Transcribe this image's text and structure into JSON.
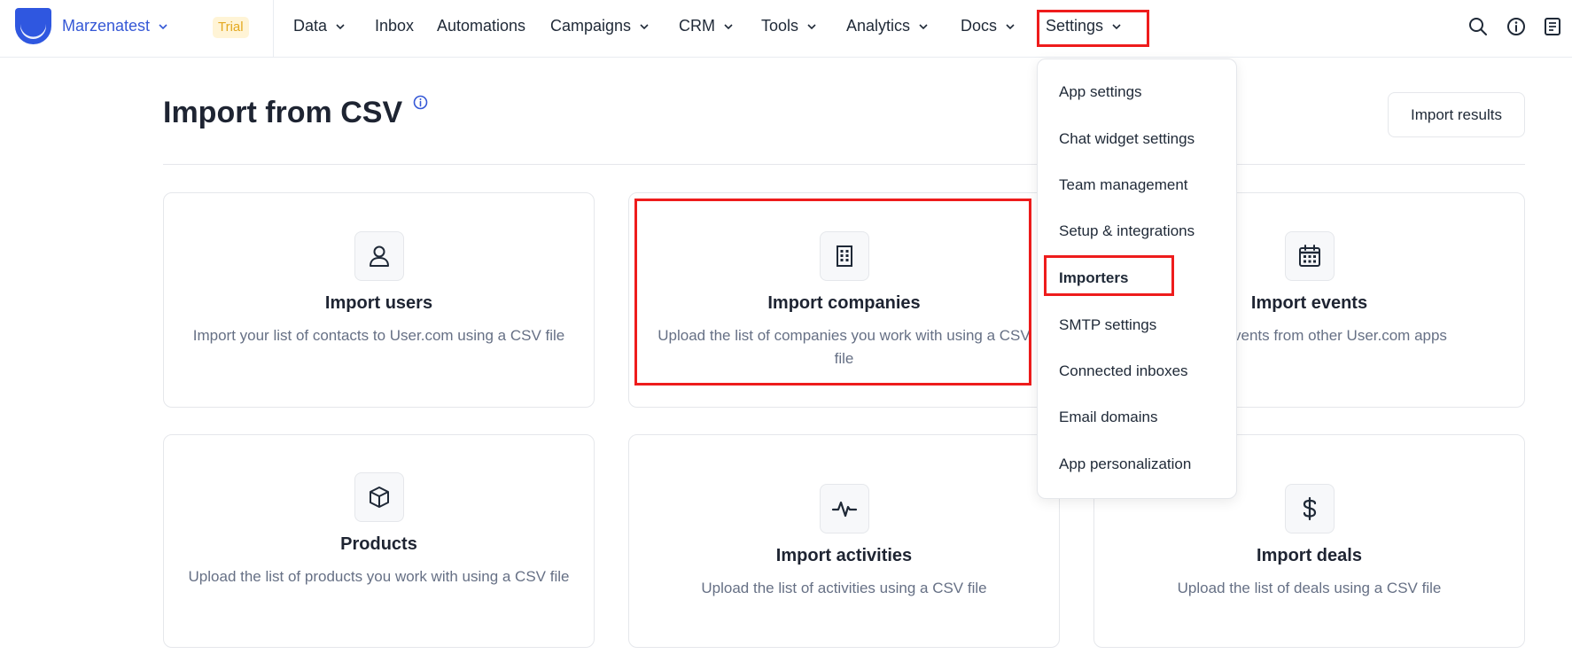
{
  "header": {
    "workspace": "Marzenatest",
    "trial_badge": "Trial",
    "nav": [
      {
        "label": "Data",
        "has_dropdown": true
      },
      {
        "label": "Inbox",
        "has_dropdown": false
      },
      {
        "label": "Automations",
        "has_dropdown": false
      },
      {
        "label": "Campaigns",
        "has_dropdown": true
      },
      {
        "label": "CRM",
        "has_dropdown": true
      },
      {
        "label": "Tools",
        "has_dropdown": true
      },
      {
        "label": "Analytics",
        "has_dropdown": true
      },
      {
        "label": "Docs",
        "has_dropdown": true
      },
      {
        "label": "Settings",
        "has_dropdown": true,
        "open": true
      }
    ],
    "icons": [
      "search-icon",
      "info-icon",
      "docs-icon"
    ]
  },
  "page": {
    "title": "Import from CSV",
    "import_results_label": "Import results"
  },
  "cards": [
    {
      "title": "Import users",
      "desc": "Import your list of contacts to User.com using a CSV file",
      "icon": "user-icon"
    },
    {
      "title": "Import companies",
      "desc": "Upload the list of companies you work with using a CSV file",
      "icon": "building-icon"
    },
    {
      "title": "Import events",
      "desc": "base of events from other User.com apps",
      "icon": "calendar-icon"
    },
    {
      "title": "Products",
      "desc": "Upload the list of products you work with using a CSV file",
      "icon": "box-icon"
    },
    {
      "title": "Import activities",
      "desc": "Upload the list of activities using a CSV file",
      "icon": "activity-icon"
    },
    {
      "title": "Import deals",
      "desc": "Upload the list of deals using a CSV file",
      "icon": "dollar-icon"
    }
  ],
  "settings_menu": {
    "items": [
      {
        "label": "App settings"
      },
      {
        "label": "Chat widget settings"
      },
      {
        "label": "Team management"
      },
      {
        "label": "Setup & integrations"
      },
      {
        "label": "Importers",
        "active": true
      },
      {
        "label": "SMTP settings"
      },
      {
        "label": "Connected inboxes"
      },
      {
        "label": "Email domains"
      },
      {
        "label": "App personalization"
      }
    ]
  },
  "colors": {
    "brand": "#3558d6",
    "trial_bg": "#fff4d6",
    "trial_text": "#e3a820",
    "highlight": "#ee1c1c"
  }
}
